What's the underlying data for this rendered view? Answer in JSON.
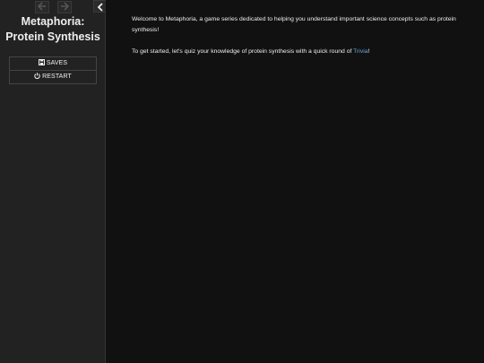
{
  "sidebar": {
    "history": {
      "back_icon": "arrow-left-icon",
      "forward_icon": "arrow-right-icon"
    },
    "toggle_icon": "chevron-left-icon",
    "story_title_line1": "Metaphoria:",
    "story_title_line2": "Protein Synthesis",
    "menu": {
      "saves_label": "SAVES",
      "saves_icon": "save-icon",
      "restart_label": "RESTART",
      "restart_icon": "power-icon"
    }
  },
  "passage": {
    "intro": "Welcome to Metaphoria, a game series dedicated to helping you understand important science concepts such as protein synthesis!",
    "prompt_before": "To get started, let's quiz your knowledge of protein synthesis with a quick round of ",
    "trivia_link": "Trivia",
    "prompt_after": "!"
  },
  "colors": {
    "background": "#111111",
    "sidebar": "#222222",
    "text": "#eeeeee",
    "link": "#68a6e0"
  }
}
